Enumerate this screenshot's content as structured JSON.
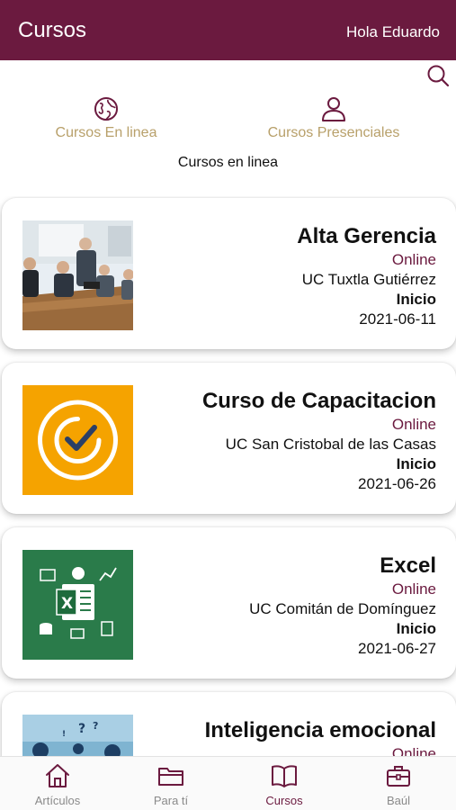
{
  "header": {
    "title": "Cursos",
    "greeting": "Hola Eduardo"
  },
  "search": {
    "icon": "search-icon"
  },
  "categories": [
    {
      "label": "Cursos En linea",
      "icon": "globe-icon"
    },
    {
      "label": "Cursos Presenciales",
      "icon": "person-icon"
    }
  ],
  "section_label": "Cursos en linea",
  "courses": [
    {
      "title": "Alta Gerencia",
      "mode": "Online",
      "campus": "UC Tuxtla Gutiérrez",
      "start_label": "Inicio",
      "date": "2021-06-11",
      "thumb": "meeting-photo"
    },
    {
      "title": "Curso de Capacitacion",
      "mode": "Online",
      "campus": "UC San Cristobal de las Casas",
      "start_label": "Inicio",
      "date": "2021-06-26",
      "thumb": "check-circle-badge"
    },
    {
      "title": "Excel",
      "mode": "Online",
      "campus": "UC Comitán de Domínguez",
      "start_label": "Inicio",
      "date": "2021-06-27",
      "thumb": "excel-badge"
    },
    {
      "title": "Inteligencia emocional",
      "mode": "Online",
      "thumb": "emotional-photo"
    }
  ],
  "tabs": [
    {
      "label": "Artículos",
      "icon": "home-icon"
    },
    {
      "label": "Para tí",
      "icon": "folder-icon"
    },
    {
      "label": "Cursos",
      "icon": "book-icon",
      "active": true
    },
    {
      "label": "Baúl",
      "icon": "briefcase-icon"
    }
  ],
  "colors": {
    "primary": "#6b1a3f",
    "category_text": "#b8a06a",
    "tab_inactive": "#8a8a8a",
    "orange": "#f5a300",
    "excel_green": "#2a7b4a"
  }
}
